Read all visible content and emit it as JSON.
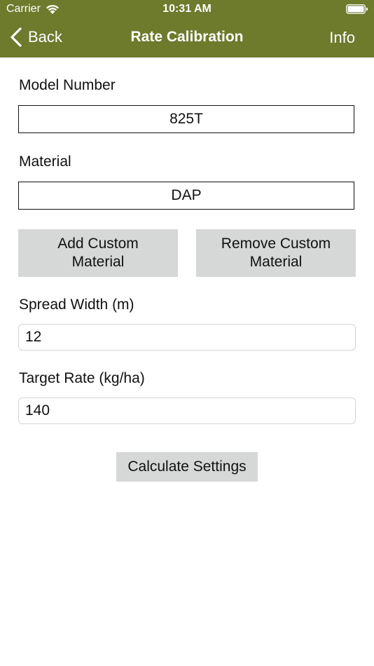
{
  "status_bar": {
    "carrier": "Carrier",
    "time": "10:31 AM"
  },
  "nav": {
    "back_label": "Back",
    "title": "Rate Calibration",
    "info_label": "Info"
  },
  "form": {
    "model_number_label": "Model Number",
    "model_number_value": "825T",
    "material_label": "Material",
    "material_value": "DAP",
    "add_custom_material": "Add Custom\nMaterial",
    "remove_custom_material": "Remove Custom\nMaterial",
    "spread_width_label": "Spread Width (m)",
    "spread_width_value": "12",
    "target_rate_label": "Target Rate (kg/ha)",
    "target_rate_value": "140",
    "calculate_button": "Calculate Settings"
  },
  "colors": {
    "nav_background": "#6e7a2c",
    "button_gray": "#d6d7d7"
  }
}
